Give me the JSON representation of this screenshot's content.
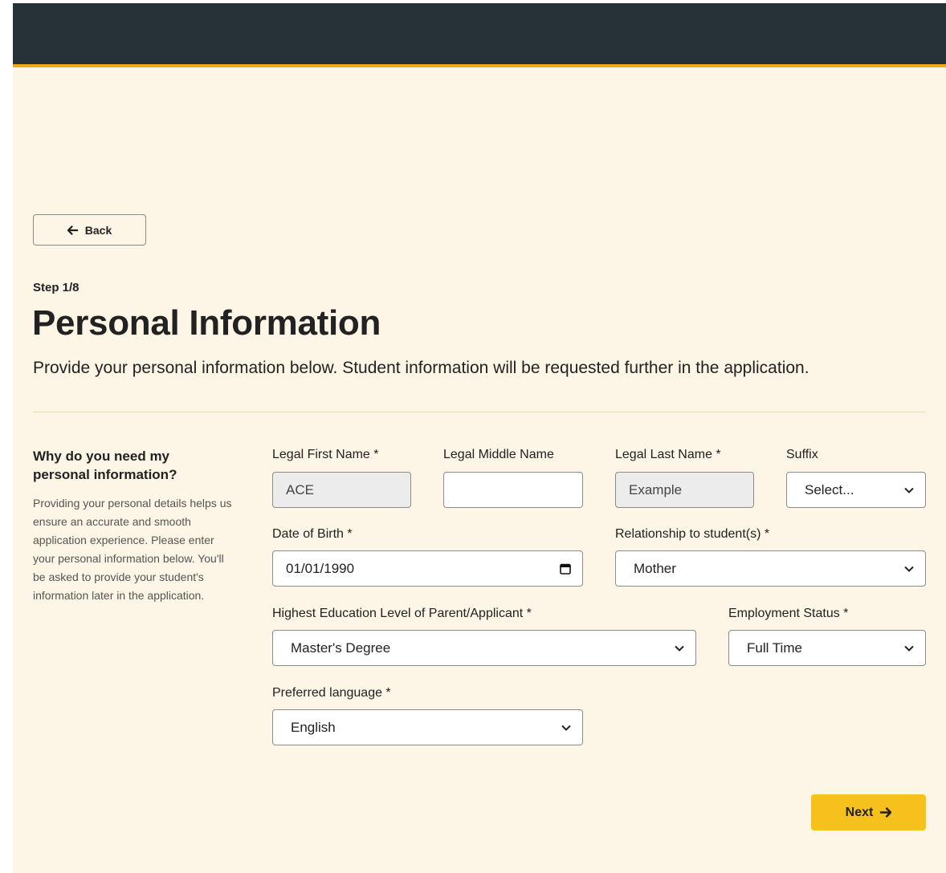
{
  "nav": {
    "back_label": "Back",
    "next_label": "Next"
  },
  "header": {
    "step": "Step 1/8",
    "title": "Personal Information",
    "subtitle": "Provide your personal information below. Student information will be requested further in the application."
  },
  "aside": {
    "heading": "Why do you need my personal information?",
    "text": "Providing your personal details helps us ensure an accurate and smooth application experience. Please enter your personal information below. You'll be asked to provide your student's information later in the application."
  },
  "form": {
    "first_name": {
      "label": "Legal First Name *",
      "value": "ACE"
    },
    "middle_name": {
      "label": "Legal Middle Name",
      "value": ""
    },
    "last_name": {
      "label": "Legal Last Name *",
      "value": "Example"
    },
    "suffix": {
      "label": "Suffix",
      "value": "Select..."
    },
    "dob": {
      "label": "Date of Birth *",
      "value": "01/01/1990"
    },
    "relationship": {
      "label": "Relationship to student(s) *",
      "value": "Mother"
    },
    "education": {
      "label": "Highest Education Level of Parent/Applicant *",
      "value": "Master's Degree"
    },
    "employment": {
      "label": "Employment Status *",
      "value": "Full Time"
    },
    "language": {
      "label": "Preferred language *",
      "value": "English"
    }
  },
  "colors": {
    "topbar": "#263238",
    "accent": "#f2a91c",
    "page_background": "#fdf5e6",
    "next_button": "#f6c11d"
  },
  "icons": {
    "back": "arrow-left-icon",
    "next": "arrow-right-icon",
    "select": "chevron-down-icon",
    "date": "calendar-icon"
  }
}
